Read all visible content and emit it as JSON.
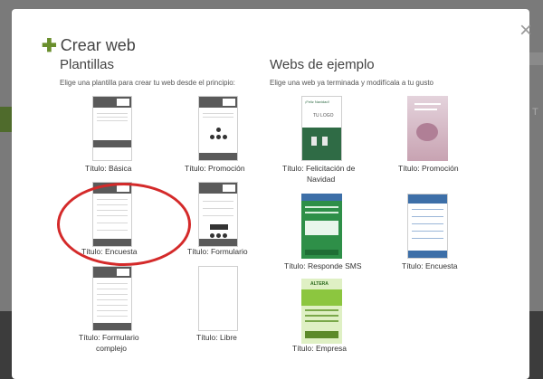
{
  "modal": {
    "title": "Crear web",
    "close_label": "×"
  },
  "templates": {
    "heading": "Plantillas",
    "description": "Elige una plantilla para crear tu web desde el principio:",
    "items": [
      {
        "label": "Título: Básica"
      },
      {
        "label": "Título: Promoción"
      },
      {
        "label": "Título: Encuesta"
      },
      {
        "label": "Título: Formulario"
      },
      {
        "label_line1": "Título: Formulario",
        "label_line2": "complejo"
      },
      {
        "label": "Título: Libre"
      }
    ]
  },
  "examples": {
    "heading": "Webs de ejemplo",
    "description": "Elige una web ya terminada y modifícala a tu gusto",
    "items": [
      {
        "label_line1": "Título: Felicitación de",
        "label_line2": "Navidad",
        "color": "#2f6b45"
      },
      {
        "label": "Título: Promoción",
        "color": "#c8a3b2"
      },
      {
        "label": "Título: Responde SMS",
        "color": "#2e8f48"
      },
      {
        "label": "Título: Encuesta",
        "color": "#3d6fa8"
      },
      {
        "label": "Título: Empresa",
        "color": "#8cc63f"
      }
    ],
    "thumb_text": {
      "logo": "TU LOGO",
      "xmas_header": "¡Feliz Navidad!",
      "altera": "ALTERA"
    }
  },
  "colors": {
    "accent_green": "#6a8f2d",
    "annotation_red": "#d42a2a"
  }
}
